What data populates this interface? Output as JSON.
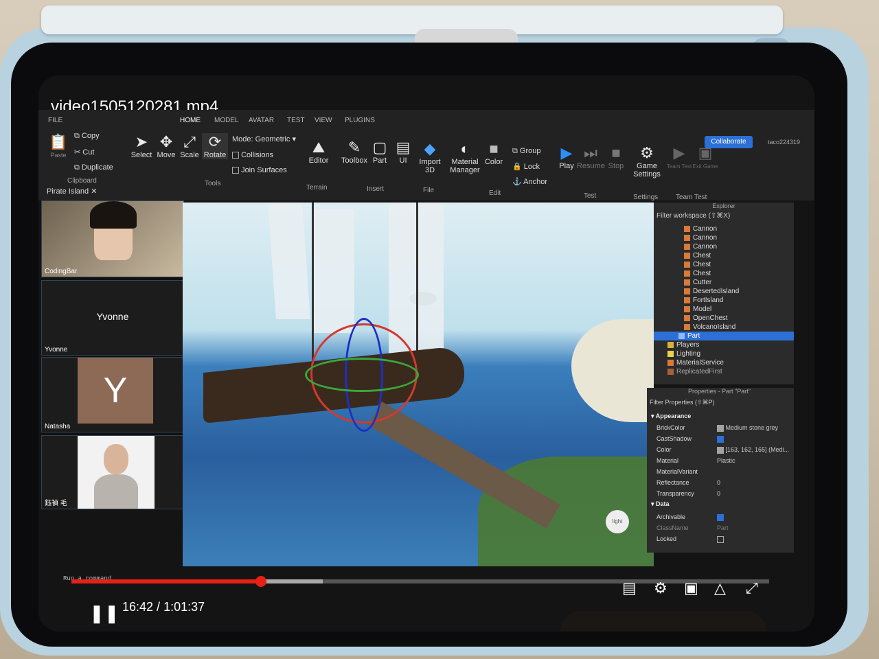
{
  "video": {
    "title": "video1505120281.mp4",
    "current_time": "16:42",
    "duration": "1:01:37",
    "progress_fraction": 0.272,
    "buffered_fraction": 0.36
  },
  "studio": {
    "menu_tabs": [
      "FILE",
      "HOME",
      "MODEL",
      "AVATAR",
      "TEST",
      "VIEW",
      "PLUGINS"
    ],
    "clipboard": {
      "paste": "Paste",
      "copy": "Copy",
      "cut": "Cut",
      "duplicate": "Duplicate",
      "group_label": "Clipboard"
    },
    "tools": {
      "select": "Select",
      "move": "Move",
      "scale": "Scale",
      "rotate": "Rotate",
      "group_label": "Tools"
    },
    "mode": {
      "label": "Mode:",
      "value": "Geometric",
      "collisions": "Collisions",
      "join_surfaces": "Join Surfaces"
    },
    "terrain": {
      "editor": "Editor",
      "group_label": "Terrain"
    },
    "insert": {
      "toolbox": "Toolbox",
      "part": "Part",
      "ui": "UI",
      "group_label": "Insert"
    },
    "file": {
      "import3d": "Import 3D",
      "group_label": "File"
    },
    "edit": {
      "material_manager": "Material Manager",
      "color": "Color",
      "group": "Group",
      "lock": "Lock",
      "anchor": "Anchor",
      "group_label": "Edit"
    },
    "test": {
      "play": "Play",
      "resume": "Resume",
      "stop": "Stop",
      "group_label": "Test"
    },
    "settings": {
      "game_settings": "Game Settings",
      "group_label": "Settings"
    },
    "team_test": {
      "team_test": "Team Test",
      "exit_game": "Exit Game",
      "group_label": "Team Test"
    },
    "collaborate": "Collaborate",
    "username": "taco224319",
    "doc_tab": "Pirate Island",
    "command_placeholder": "Run a command"
  },
  "participants": [
    {
      "name": "CodingBar",
      "type": "video"
    },
    {
      "name": "Yvonne",
      "type": "name"
    },
    {
      "name": "Natasha",
      "initial": "Y",
      "type": "initial"
    },
    {
      "name": "鈺禎 毛",
      "type": "video"
    }
  ],
  "explorer": {
    "title": "Explorer",
    "filter": "Filter workspace (⇧⌘X)",
    "items": [
      "Cannon",
      "Cannon",
      "Cannon",
      "Chest",
      "Chest",
      "Chest",
      "Cutter",
      "DesertedIsland",
      "FortIsland",
      "Model",
      "OpenChest",
      "VolcanoIsland",
      "Part",
      "Players",
      "Lighting",
      "MaterialService",
      "ReplicatedFirst"
    ],
    "selected": "Part"
  },
  "properties": {
    "title": "Properties - Part \"Part\"",
    "filter": "Filter Properties (⇧⌘P)",
    "appearance_label": "Appearance",
    "data_label": "Data",
    "rows": {
      "brick_color": {
        "k": "BrickColor",
        "v": "Medium stone grey"
      },
      "cast_shadow": {
        "k": "CastShadow",
        "v": ""
      },
      "color": {
        "k": "Color",
        "v": "[163, 162, 165] (Medi..."
      },
      "material": {
        "k": "Material",
        "v": "Plastic"
      },
      "material_variant": {
        "k": "MaterialVariant",
        "v": ""
      },
      "reflectance": {
        "k": "Reflectance",
        "v": "0"
      },
      "transparency": {
        "k": "Transparency",
        "v": "0"
      },
      "archivable": {
        "k": "Archivable",
        "v": ""
      },
      "classname": {
        "k": "ClassName",
        "v": "Part"
      },
      "locked": {
        "k": "Locked",
        "v": ""
      }
    }
  },
  "viewport": {
    "light_button": "light"
  }
}
